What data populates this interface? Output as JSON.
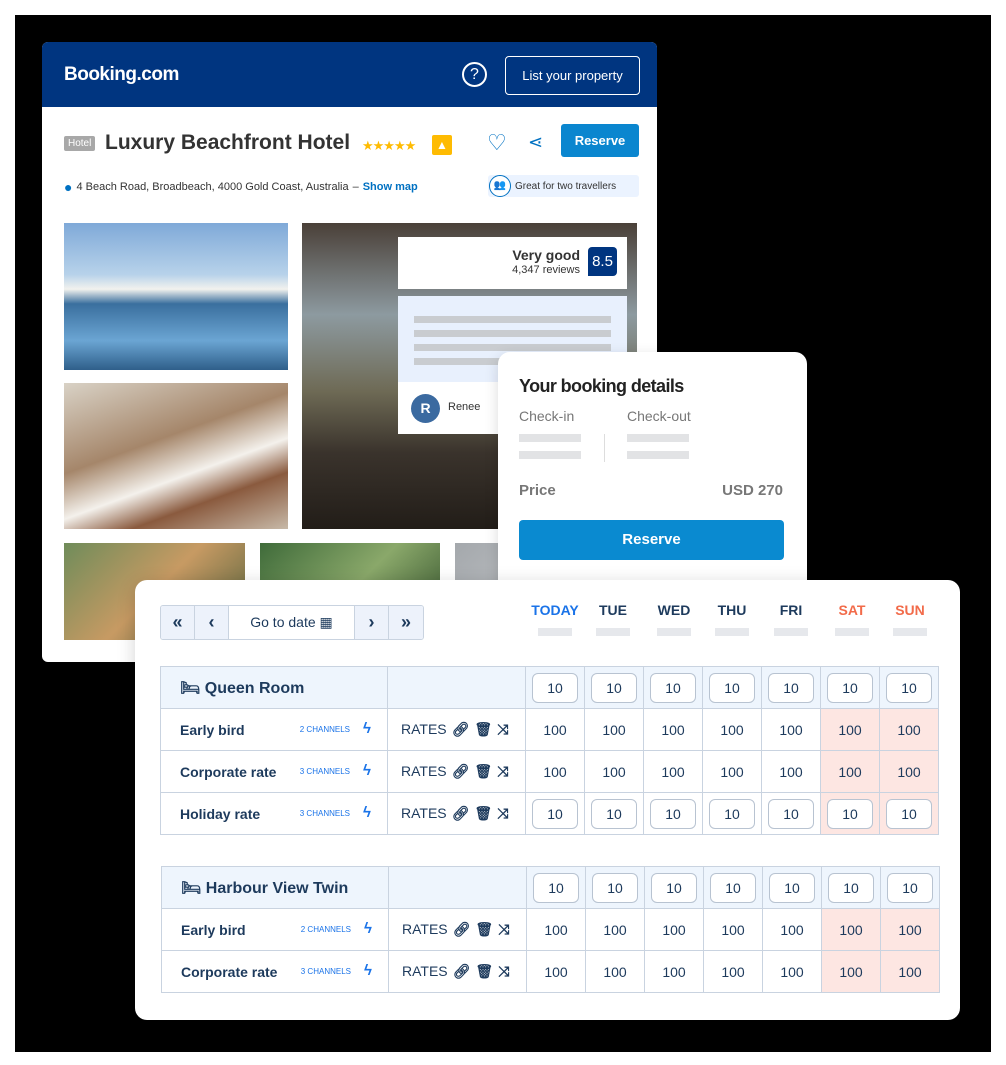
{
  "header": {
    "logo": "Booking.com",
    "help_icon": "?",
    "list_property": "List your property"
  },
  "hotel": {
    "type_tag": "Hotel",
    "name": "Luxury Beachfront Hotel",
    "stars": "★★★★★",
    "thumb": "👍",
    "address": "4 Beach Road, Broadbeach, 4000 Gold Coast, Australia",
    "dash": "–",
    "show_map": "Show map",
    "reserve": "Reserve",
    "badge": "Great for two travellers"
  },
  "review": {
    "label": "Very good",
    "count": "4,347 reviews",
    "score": "8.5",
    "reviewer_initial": "R",
    "reviewer": "Renee"
  },
  "booking_details": {
    "title": "Your booking details",
    "checkin": "Check-in",
    "checkout": "Check-out",
    "price_label": "Price",
    "price_value": "USD 270",
    "reserve": "Reserve"
  },
  "calendar": {
    "nav": {
      "first": "«",
      "prev": "‹",
      "go_to_date": "Go to date",
      "next": "›",
      "last": "»"
    },
    "days": [
      "TODAY",
      "TUE",
      "WED",
      "THU",
      "FRI",
      "SAT",
      "SUN"
    ],
    "colors": {
      "today": "#1a73e8",
      "weekend": "#f26b4a",
      "weekend_bg": "#fde6e2"
    },
    "rates_label": "RATES",
    "rooms": [
      {
        "name": "Queen Room",
        "availability": [
          "10",
          "10",
          "10",
          "10",
          "10",
          "10",
          "10"
        ],
        "plans": [
          {
            "name": "Early bird",
            "channels": "2 CHANNELS",
            "values": [
              "100",
              "100",
              "100",
              "100",
              "100",
              "100",
              "100"
            ]
          },
          {
            "name": "Corporate rate",
            "channels": "3 CHANNELS",
            "values": [
              "100",
              "100",
              "100",
              "100",
              "100",
              "100",
              "100"
            ]
          },
          {
            "name": "Holiday rate",
            "channels": "3 CHANNELS",
            "values": [
              "10",
              "10",
              "10",
              "10",
              "10",
              "10",
              "10"
            ],
            "boxed": true
          }
        ]
      },
      {
        "name": "Harbour View Twin",
        "availability": [
          "10",
          "10",
          "10",
          "10",
          "10",
          "10",
          "10"
        ],
        "plans": [
          {
            "name": "Early bird",
            "channels": "2 CHANNELS",
            "values": [
              "100",
              "100",
              "100",
              "100",
              "100",
              "100",
              "100"
            ]
          },
          {
            "name": "Corporate rate",
            "channels": "3 CHANNELS",
            "values": [
              "100",
              "100",
              "100",
              "100",
              "100",
              "100",
              "100"
            ]
          }
        ]
      }
    ]
  }
}
